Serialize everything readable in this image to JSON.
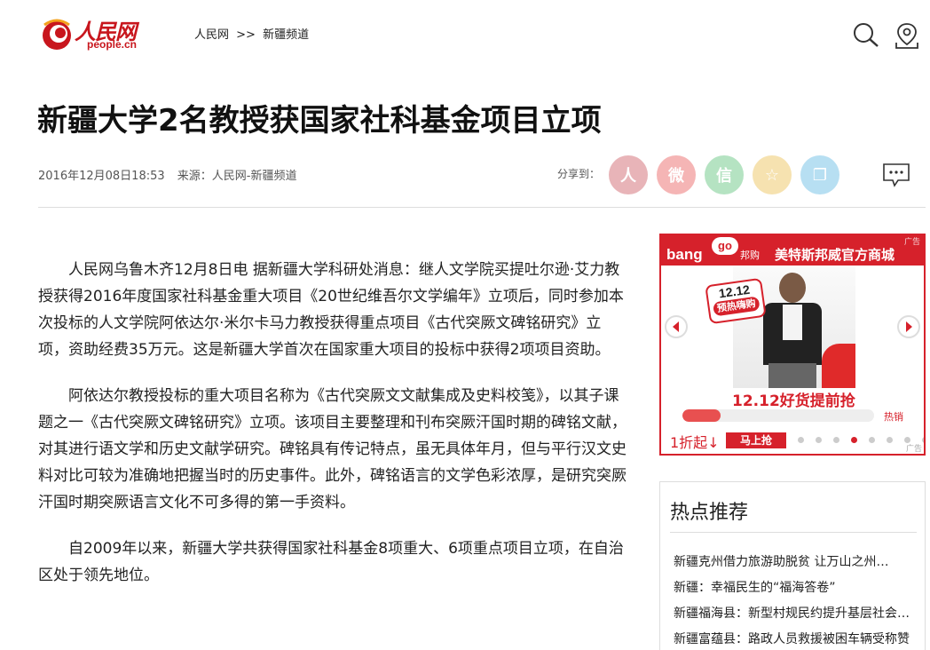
{
  "header": {
    "logo_cn": "人民网",
    "logo_en": "people.cn",
    "breadcrumb": [
      "人民网",
      ">>",
      "新疆频道"
    ],
    "icons": [
      "search-icon",
      "location-icon"
    ]
  },
  "article": {
    "title": "新疆大学2名教授获国家社科基金项目立项",
    "datetime": "2016年12月08日18:53",
    "source": "来源：人民网-新疆频道",
    "share_label": "分享到：",
    "paragraphs": [
      "人民网乌鲁木齐12月8日电 据新疆大学科研处消息：继人文学院买提吐尔逊·艾力教授获得2016年度国家社科基金重大项目《20世纪维吾尔文学编年》立项后，同时参加本次投标的人文学院阿依达尔·米尔卡马力教授获得重点项目《古代突厥文碑铭研究》立项，资助经费35万元。这是新疆大学首次在国家重大项目的投标中获得2项项目资助。",
      "阿依达尔教授投标的重大项目名称为《古代突厥文文献集成及史料校笺》，以其子课题之一《古代突厥文碑铭研究》立项。该项目主要整理和刊布突厥汗国时期的碑铭文献，对其进行语文学和历史文献学研究。碑铭具有传记特点，虽无具体年月，但与平行汉文史料对比可较为准确地把握当时的历史事件。此外，碑铭语言的文学色彩浓厚，是研究突厥汗国时期突厥语言文化不可多得的第一手资料。",
      "自2009年以来，新疆大学共获得国家社科基金8项重大、6项重点项目立项，在自治区处于领先地位。"
    ]
  },
  "share_buttons": [
    {
      "name": "people-weibo",
      "glyph": "人",
      "color": "#e8b4b8",
      "fg": "#fff"
    },
    {
      "name": "sina-weibo",
      "glyph": "微",
      "color": "#f5b5b5",
      "fg": "#fff"
    },
    {
      "name": "wechat",
      "glyph": "信",
      "color": "#b5e3c2",
      "fg": "#fff"
    },
    {
      "name": "favorite",
      "glyph": "☆",
      "color": "#f6e2b0",
      "fg": "#fff"
    },
    {
      "name": "copy",
      "glyph": "❐",
      "color": "#b7dff2",
      "fg": "#fff"
    }
  ],
  "ad": {
    "bang": "bang",
    "go": "go",
    "bangpin": "邦购",
    "brand": "美特斯邦威官方商城",
    "tag": "广告",
    "sticker_num": "12.12",
    "sticker_txt": "预热嗨购",
    "promo": "12.12好货提前抢",
    "hot": "热销",
    "price": "1折起↓",
    "buy": "马上抢",
    "progress": 0.2,
    "dots": 8,
    "active_dot": 3,
    "foot": "广告",
    "accent": "#d6212b"
  },
  "hot": {
    "title": "热点推荐",
    "items": [
      "新疆克州借力旅游助脱贫 让万山之州…",
      "新疆：幸福民生的“福海答卷”",
      "新疆福海县：新型村规民约提升基层社会…",
      "新疆富蕴县：路政人员救援被困车辆受称赞"
    ]
  }
}
